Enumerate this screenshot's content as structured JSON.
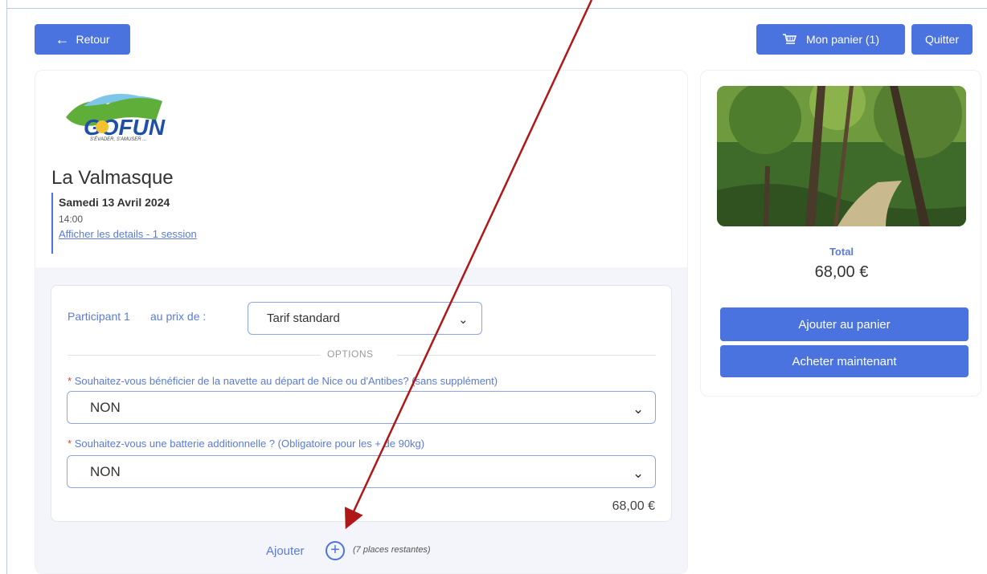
{
  "header": {
    "back_label": "Retour",
    "cart_label": "Mon panier (1)",
    "quit_label": "Quitter"
  },
  "event": {
    "logo_text": "GOFUN",
    "logo_tagline": "S'ÉVADER, S'AMUSER ...",
    "title": "La Valmasque",
    "date": "Samedi 13 Avril 2024",
    "time": "14:00",
    "details_link": "Afficher les details - 1 session"
  },
  "participant": {
    "label": "Participant 1",
    "price_label": "au prix de :",
    "tarif_value": "Tarif standard",
    "options_heading": "OPTIONS",
    "questions": [
      {
        "required_mark": "*",
        "label": "Souhaitez-vous bénéficier de la navette au départ de Nice ou d'Antibes? (sans supplément)",
        "value": "NON"
      },
      {
        "required_mark": "*",
        "label": "Souhaitez-vous une batterie additionnelle ? (Obligatoire pour les + de 90kg)",
        "value": "NON"
      }
    ],
    "price": "68,00 €"
  },
  "add_participant": {
    "label": "Ajouter",
    "remaining": "(7 places restantes)"
  },
  "summary": {
    "total_label": "Total",
    "total_value": "68,00 €",
    "add_to_cart_label": "Ajouter au panier",
    "buy_now_label": "Acheter maintenant"
  },
  "icons": {
    "back": "arrow-left-icon",
    "cart": "shopping-cart-icon",
    "chevron": "chevron-down-icon",
    "add": "plus-circle-icon"
  },
  "colors": {
    "accent": "#4a73e0",
    "link": "#5b7bd6",
    "required": "#e04444",
    "annotation_arrow": "#b01818"
  }
}
